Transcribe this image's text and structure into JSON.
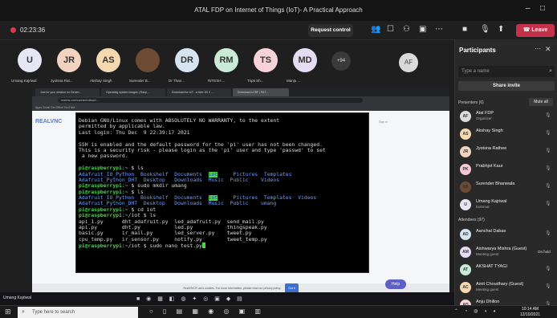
{
  "window": {
    "title": "ATAL FDP on Internet of Things (IoT)- A Practical Approach"
  },
  "meeting": {
    "timer": "02:23:36",
    "request_control_label": "Request control",
    "leave_label": "Leave"
  },
  "participants_strip": {
    "tiles": [
      {
        "initials": "U",
        "name": "Umang Kajriwal",
        "color": "#e6e6f5"
      },
      {
        "initials": "JR",
        "name": "Jyotsna Rat...",
        "color": "#f2d3bf"
      },
      {
        "initials": "AS",
        "name": "Akshay Singh",
        "color": "#f4d8b0"
      },
      {
        "initials": "",
        "name": "Surender B...",
        "color": "#6d4a32"
      },
      {
        "initials": "DR",
        "name": "Dr Than...",
        "color": "#d6e4f0"
      },
      {
        "initials": "RM",
        "name": "RITESH ...",
        "color": "#c9ead6"
      },
      {
        "initials": "TS",
        "name": "Tripti Sh...",
        "color": "#f7d2d8"
      },
      {
        "initials": "MD",
        "name": "Manju ...",
        "color": "#e3dcf3"
      }
    ],
    "more": "+94",
    "extra_tile": "AF"
  },
  "browser": {
    "tabs": [
      "Just for your session on Generi...",
      "Operating system images | Rasp...",
      "Download for IoT - a beer 2D 0 ...",
      "Download IoTBF | PAT..."
    ],
    "url": "realvnc.com/connect/viewer/...",
    "bookmarks": "Apps   Gmail   Get Office   YouTube",
    "site_logo": "REALVNC",
    "sign_in": "Sign in",
    "cookie_text": "RealVNC® uses cookies. For more information, please read our privacy policy.",
    "cookie_button": "Got it",
    "help_button": "Help"
  },
  "terminal": {
    "lines": [
      [
        {
          "t": "Debian GNU/Linux comes with ABSOLUTELY NO WARRANTY, to the extent"
        }
      ],
      [
        {
          "t": "permitted by applicable law."
        }
      ],
      [
        {
          "t": "Last login: Thu Dec  9 22:39:17 2021"
        }
      ],
      [
        {
          "t": ""
        }
      ],
      [
        {
          "t": "SSH is enabled and the default password for the 'pi' user has not been changed."
        }
      ],
      [
        {
          "t": "This is a security risk - please login as the 'pi' user and type 'passwd' to set"
        }
      ],
      [
        {
          "t": " a new password."
        }
      ],
      [
        {
          "t": ""
        }
      ],
      [
        {
          "t": "pi@raspberrypi",
          "c": "green"
        },
        {
          "t": ":~ $ ls"
        }
      ],
      [
        {
          "t": "Adafruit_IO_Python  Bookshelf  Documents  ",
          "c": "blue"
        },
        {
          "t": "iot",
          "c": "hl"
        },
        {
          "t": "     Pictures  Templates",
          "c": "blue"
        }
      ],
      [
        {
          "t": "Adafruit_Python_DHT  Desktop   Downloads  Music  Public    Videos",
          "c": "blue"
        }
      ],
      [
        {
          "t": "pi@raspberrypi",
          "c": "green"
        },
        {
          "t": ":~ $ sudo mkdir umang"
        }
      ],
      [
        {
          "t": "pi@raspberrypi",
          "c": "green"
        },
        {
          "t": ":~ $ ls"
        }
      ],
      [
        {
          "t": "Adafruit_IO_Python  Bookshelf  Documents  ",
          "c": "blue"
        },
        {
          "t": "iot",
          "c": "hl"
        },
        {
          "t": "     Pictures  Templates  Videos",
          "c": "blue"
        }
      ],
      [
        {
          "t": "Adafruit_Python_DHT  Desktop   Downloads  Music  Public    umang",
          "c": "blue"
        }
      ],
      [
        {
          "t": "pi@raspberrypi",
          "c": "green"
        },
        {
          "t": ":~ $ cd iot"
        }
      ],
      [
        {
          "t": "pi@raspberrypi",
          "c": "green"
        },
        {
          "t": ":~/iot $ ls"
        }
      ],
      [
        {
          "t": "api_1.py      dht_adafruit.py  led_adafruit.py  send_mail.py"
        }
      ],
      [
        {
          "t": "api.py        dht.py           led.py           thingspeak.py"
        }
      ],
      [
        {
          "t": "basic.py      ir_mail.py       led_server.py    tweet.py"
        }
      ],
      [
        {
          "t": "cpu_temp.py   ir_sensor.py     notify.py        tweet_temp.py"
        }
      ],
      [
        {
          "t": "pi@raspberrypi",
          "c": "green"
        },
        {
          "t": ":~/iot $ sudo nano test.py"
        }
      ]
    ]
  },
  "remote_taskbar": {
    "presenter_name": "Umang Kajriwal"
  },
  "panel": {
    "title": "Participants",
    "search_placeholder": "Type a name",
    "share_invite": "Share invite",
    "presenters_header": "Presenters (6)",
    "mute_all": "Mute all",
    "presenters": [
      {
        "initials": "AF",
        "name": "Atal FDP",
        "sub": "Organizer",
        "color": "#dcdcdc"
      },
      {
        "initials": "AS",
        "name": "Akshay Singh",
        "sub": "",
        "color": "#f4d8b0"
      },
      {
        "initials": "JR",
        "name": "Jyotsna Rathee",
        "sub": "",
        "color": "#f2d3bf"
      },
      {
        "initials": "PK",
        "name": "Prabhjot Kaur",
        "sub": "",
        "color": "#f7c6d4"
      },
      {
        "initials": "SB",
        "name": "Surender Bhanwala",
        "sub": "",
        "color": "#6d4a32"
      },
      {
        "initials": "U",
        "name": "Umang Kajriwal",
        "sub": "External",
        "color": "#e6e6f5"
      }
    ],
    "attendees_header": "Attendees (97)",
    "attendees": [
      {
        "initials": "AD",
        "name": "Aanchal Dabas",
        "sub": "",
        "status": "",
        "color": "#d6e4f0"
      },
      {
        "initials": "AM",
        "name": "Aishwarya Mishra (Guest)",
        "sub": "Meeting guest",
        "status": "On hold",
        "color": "#e3dcf3"
      },
      {
        "initials": "AT",
        "name": "AKSHAT TYAGI",
        "sub": "",
        "status": "",
        "color": "#c9ead6"
      },
      {
        "initials": "AC",
        "name": "Amit Choudhary (Guest)",
        "sub": "Meeting guest",
        "status": "",
        "color": "#f4d8b0"
      },
      {
        "initials": "AD",
        "name": "Anju Dhillon",
        "sub": "",
        "status": "",
        "color": "#f7d2d8"
      }
    ]
  },
  "windows_taskbar": {
    "search_placeholder": "Type here to search",
    "time": "10:14 AM",
    "date": "12/10/2021"
  }
}
